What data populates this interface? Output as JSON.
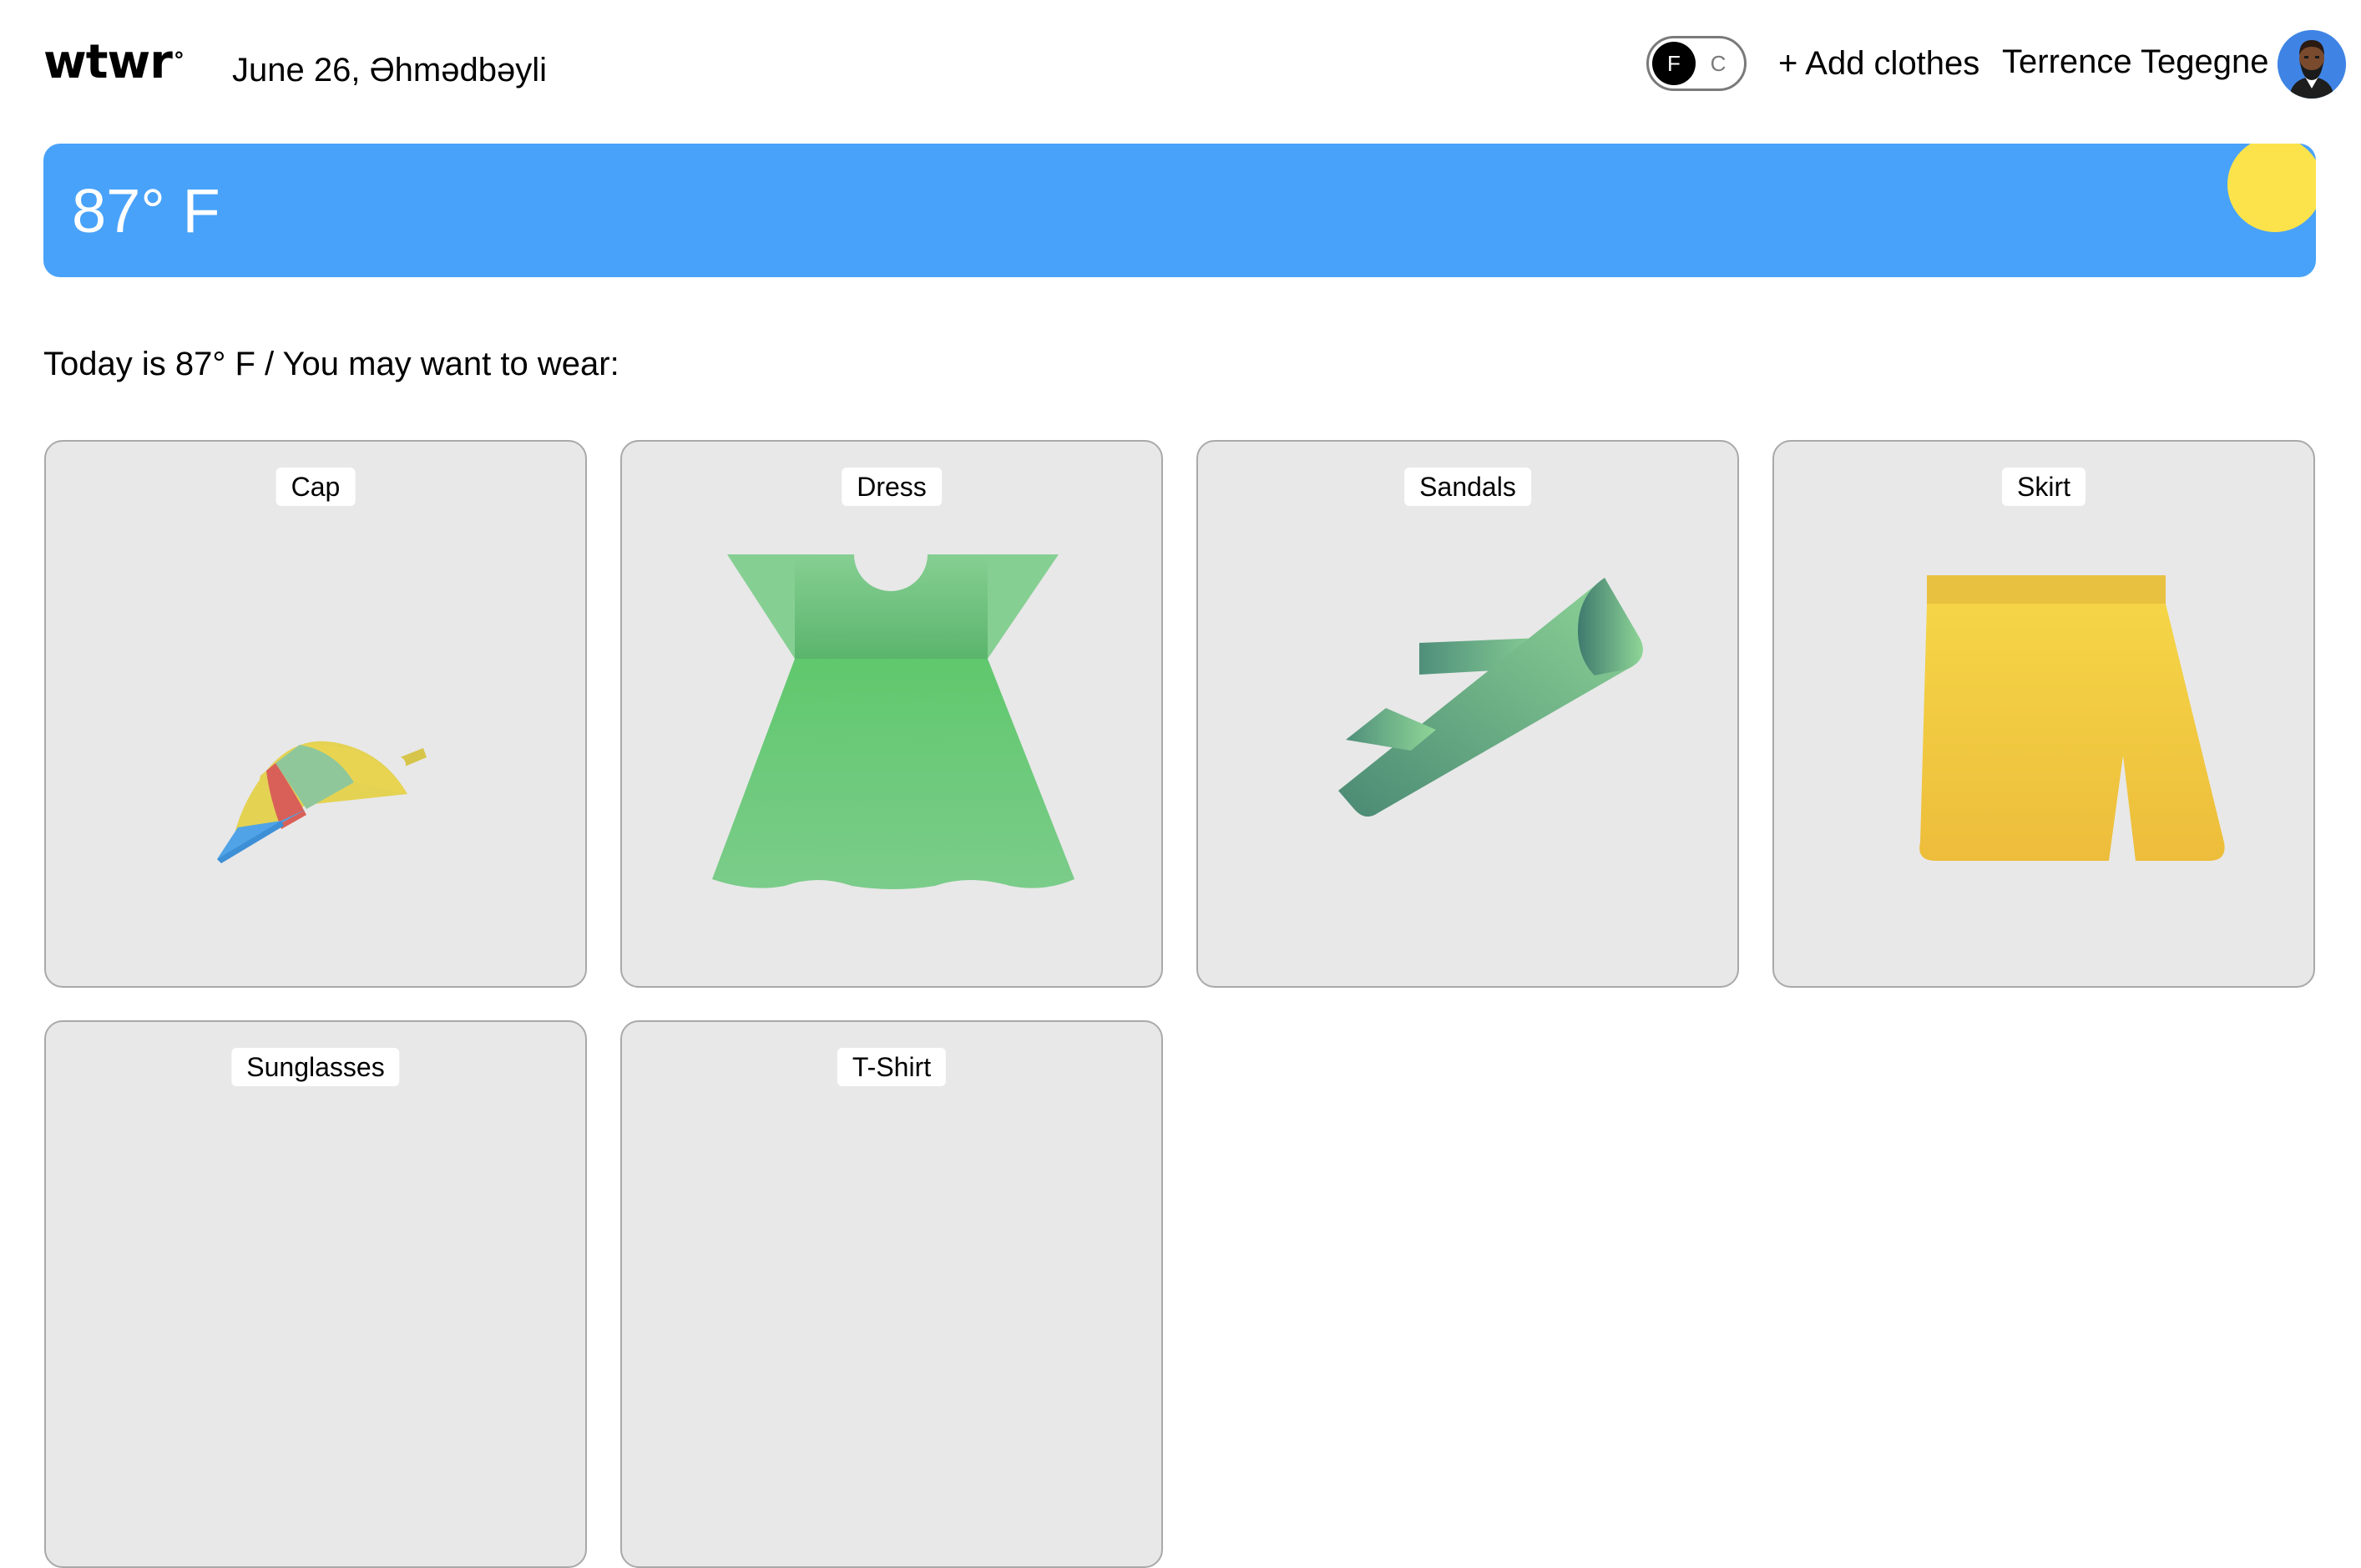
{
  "header": {
    "logo": "wtwr",
    "logo_mark": "°",
    "date_location": "June 26, Əhmədbəyli",
    "temp_toggle": {
      "selected": "F",
      "other": "C"
    },
    "add_clothes_label": "+ Add clothes",
    "user_name": "Terrence Tegegne",
    "avatar_icon": "user-avatar"
  },
  "weather": {
    "temperature": "87° F",
    "icon": "sun-icon",
    "background_color": "#48a2f9",
    "sun_color": "#fce34b"
  },
  "main": {
    "message": "Today is 87° F / You may want to wear:"
  },
  "items": [
    {
      "label": "Cap",
      "icon": "cap-icon"
    },
    {
      "label": "Dress",
      "icon": "dress-icon"
    },
    {
      "label": "Sandals",
      "icon": "sandals-icon"
    },
    {
      "label": "Skirt",
      "icon": "skirt-icon"
    },
    {
      "label": "Sunglasses",
      "icon": "sunglasses-icon"
    },
    {
      "label": "T-Shirt",
      "icon": "tshirt-icon"
    }
  ]
}
